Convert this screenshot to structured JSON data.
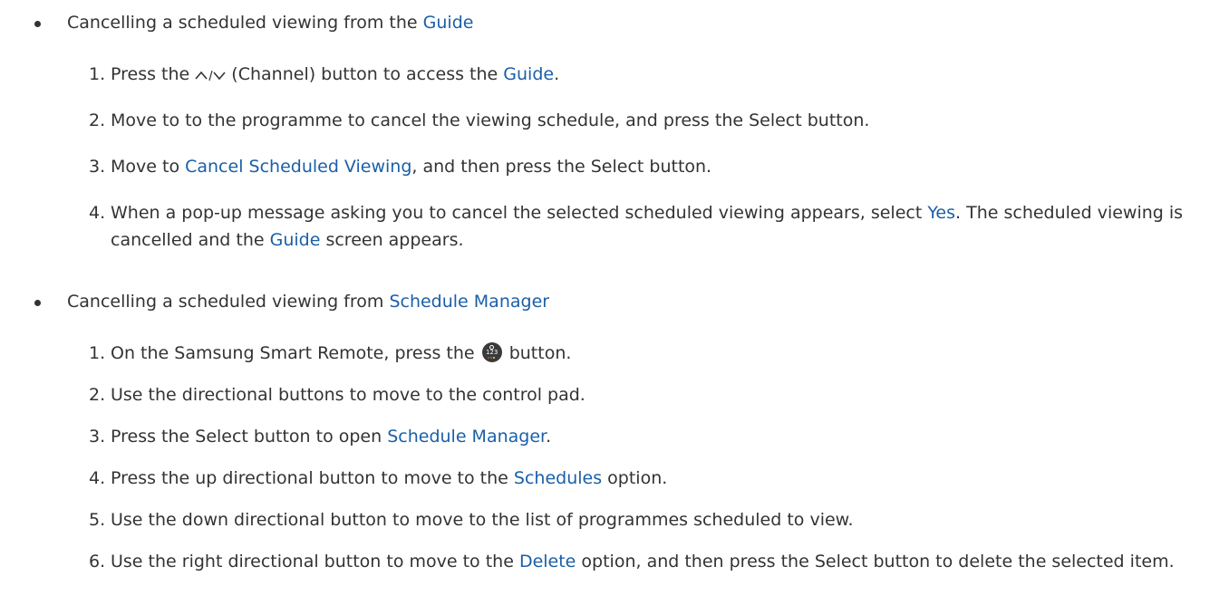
{
  "section1": {
    "bullet_prefix": "Cancelling a scheduled viewing from the ",
    "bullet_link": "Guide",
    "steps": [
      {
        "num": "1.",
        "before_icon": "Press the ",
        "icon": "channel-up-down-icon",
        "after_icon": " (Channel) button to access the ",
        "link": "Guide",
        "after_link": "."
      },
      {
        "num": "2.",
        "text": "Move to to the programme to cancel the viewing schedule, and press the Select button."
      },
      {
        "num": "3.",
        "before": "Move to ",
        "link": "Cancel Scheduled Viewing",
        "after": ", and then press the Select button."
      },
      {
        "num": "4.",
        "before": "When a pop-up message asking you to cancel the selected scheduled viewing appears, select ",
        "link1": "Yes",
        "mid": ". The scheduled viewing is cancelled and the ",
        "link2": "Guide",
        "after": " screen appears."
      }
    ]
  },
  "section2": {
    "bullet_prefix": "Cancelling a scheduled viewing from ",
    "bullet_link": "Schedule Manager",
    "steps": [
      {
        "num": "1.",
        "before_icon": "On the Samsung Smart Remote, press the ",
        "icon": "color-123-button-icon",
        "icon_text": "123",
        "after_icon": " button."
      },
      {
        "num": "2.",
        "text": "Use the directional buttons to move to the control pad."
      },
      {
        "num": "3.",
        "before": "Press the Select button to open ",
        "link": "Schedule Manager",
        "after": "."
      },
      {
        "num": "4.",
        "before": "Press the up directional button to move to the ",
        "link": "Schedules",
        "after": " option."
      },
      {
        "num": "5.",
        "text": "Use the down directional button to move to the list of programmes scheduled to view."
      },
      {
        "num": "6.",
        "before": "Use the right directional button to move to the ",
        "link": "Delete",
        "after": " option, and then press the Select button to delete the selected item."
      }
    ]
  },
  "colors": {
    "text": "#333333",
    "highlight": "#1a5fa8"
  }
}
